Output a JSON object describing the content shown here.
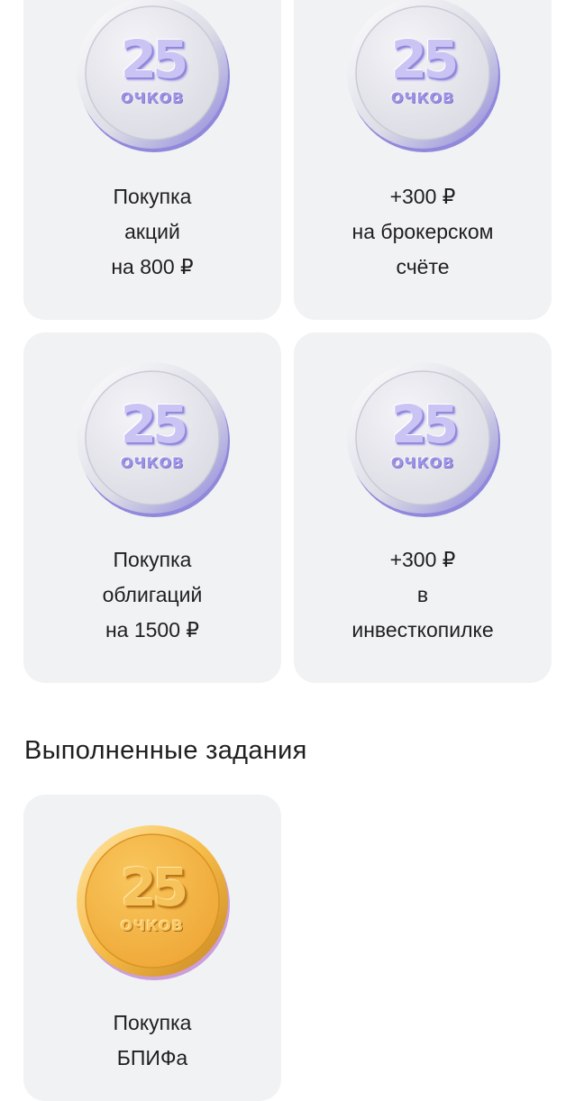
{
  "tasks": [
    {
      "points": "25",
      "unit": "ОЧКОВ",
      "lines": [
        "Покупка",
        "акций",
        "на 800 ₽"
      ],
      "coin": "silver"
    },
    {
      "points": "25",
      "unit": "ОЧКОВ",
      "lines": [
        "+300 ₽",
        "на брокерском",
        "счёте"
      ],
      "coin": "silver"
    },
    {
      "points": "25",
      "unit": "ОЧКОВ",
      "lines": [
        "Покупка",
        "облигаций",
        "на 1500 ₽"
      ],
      "coin": "silver"
    },
    {
      "points": "25",
      "unit": "ОЧКОВ",
      "lines": [
        "+300 ₽",
        "в",
        "инвесткопилке"
      ],
      "coin": "silver"
    }
  ],
  "completed_section": {
    "title": "Выполненные задания",
    "tasks": [
      {
        "points": "25",
        "unit": "ОЧКОВ",
        "lines": [
          "Покупка",
          "БПИФа"
        ],
        "coin": "gold"
      }
    ]
  },
  "colors": {
    "card_bg": "#f1f2f4",
    "silver_coin": "#e4e5ec",
    "silver_accent": "#8f86da",
    "gold_coin": "#f4b43c",
    "gold_accent": "#b8741a"
  }
}
